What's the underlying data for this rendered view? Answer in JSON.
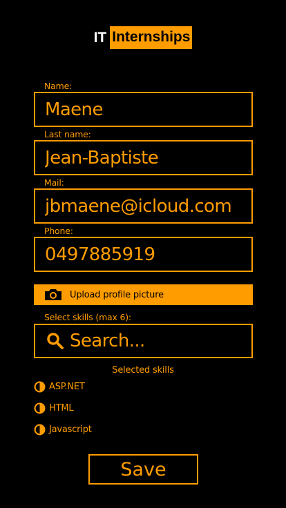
{
  "header": {
    "logo_prefix": "IT",
    "logo_highlight": "Internships"
  },
  "form": {
    "name_label": "Name:",
    "name_value": "Maene",
    "lastname_label": "Last name:",
    "lastname_value": "Jean-Baptiste",
    "mail_label": "Mail:",
    "mail_value": "jbmaene@icloud.com",
    "phone_label": "Phone:",
    "phone_value": "0497885919",
    "upload_label": "Upload profile picture",
    "skills_label": "Select skills (max 6):",
    "search_placeholder": "Search..."
  },
  "selected": {
    "title": "Selected skills",
    "skills": [
      "ASP.NET",
      "HTML",
      "Javascript"
    ]
  },
  "actions": {
    "save_label": "Save"
  },
  "colors": {
    "accent": "#ff9c00",
    "background": "#000000"
  },
  "icons": {
    "upload": "camera-icon",
    "search": "search-icon",
    "skill": "half-circle-icon"
  }
}
